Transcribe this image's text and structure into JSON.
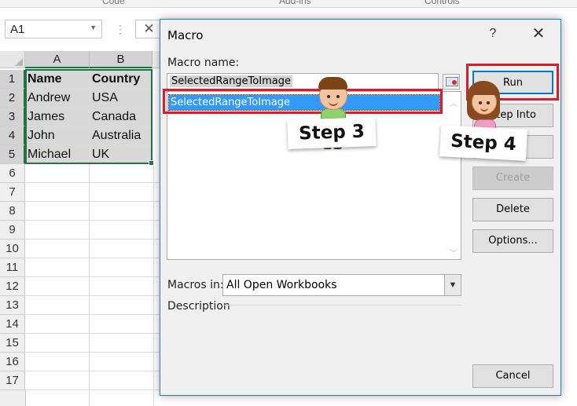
{
  "ribbon": {
    "groups": [
      "Code",
      "Add-ins",
      "Controls"
    ]
  },
  "name_box": {
    "value": "A1"
  },
  "grid": {
    "columns": [
      "A",
      "B"
    ],
    "row_numbers": [
      "1",
      "2",
      "3",
      "4",
      "5",
      "6",
      "7",
      "8",
      "9",
      "10",
      "11",
      "12",
      "13",
      "14",
      "15",
      "16",
      "17"
    ],
    "rows": [
      [
        "Name",
        "Country"
      ],
      [
        "Andrew",
        "USA"
      ],
      [
        "James",
        "Canada"
      ],
      [
        "John",
        "Australia"
      ],
      [
        "Michael",
        "UK"
      ]
    ]
  },
  "dialog": {
    "title": "Macro",
    "help_label": "?",
    "close_label": "✕",
    "macro_name_label": "Macro name:",
    "macro_name_value": "SelectedRangeToImage",
    "list_items": [
      "SelectedRangeToImage"
    ],
    "buttons": {
      "run": "Run",
      "step_into": "Step Into",
      "edit": "Edit",
      "create": "Create",
      "delete": "Delete",
      "options": "Options..."
    },
    "macros_in_label": "Macros in:",
    "macros_in_value": "All Open Workbooks",
    "description_label": "Description",
    "cancel_label": "Cancel"
  },
  "annotations": {
    "step3": "Step 3",
    "step4": "Step 4",
    "highlight_color": "#e11a2b"
  },
  "colors": {
    "excel_green": "#217346",
    "selection_blue": "#3399ff",
    "dialog_border": "#2b78c5"
  }
}
